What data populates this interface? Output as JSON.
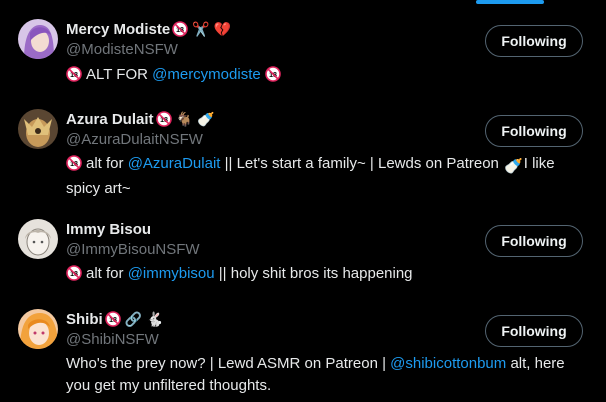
{
  "follow_label": "Following",
  "accent_color": "#1d9bf0",
  "users": [
    {
      "display_name": "Mercy Modiste",
      "handle": "@ModisteNSFW",
      "badges": [
        "no-under-18-icon",
        "scissors-icon",
        "broken-heart-icon"
      ],
      "bio": {
        "badge": "18",
        "before": "ALT FOR ",
        "link": "@mercymodiste",
        "after": ""
      },
      "follow_state": "Following"
    },
    {
      "display_name": "Azura Dulait",
      "handle": "@AzuraDulaitNSFW",
      "badges": [
        "no-under-18-icon",
        "goat-icon",
        "baby-bottle-icon"
      ],
      "bio": {
        "badge": "18",
        "before": "alt for ",
        "link": "@AzuraDulait",
        "after": " || Let's start a family~ | Lewds on Patreon ",
        "after2": "I like spicy art~"
      },
      "follow_state": "Following"
    },
    {
      "display_name": "Immy Bisou",
      "handle": "@ImmyBisouNSFW",
      "badges": [],
      "bio": {
        "badge": "18",
        "before": "alt for ",
        "link": "@immybisou",
        "after": " || holy shit bros its happening"
      },
      "follow_state": "Following"
    },
    {
      "display_name": "Shibi",
      "handle": "@ShibiNSFW",
      "badges": [
        "no-under-18-icon",
        "link-icon",
        "rabbit-icon"
      ],
      "bio": {
        "before": "Who's the prey now? | Lewd ASMR on Patreon | ",
        "link": "@shibicottonbum",
        "after": " alt, here you get my unfiltered thoughts."
      },
      "follow_state": "Following"
    }
  ]
}
